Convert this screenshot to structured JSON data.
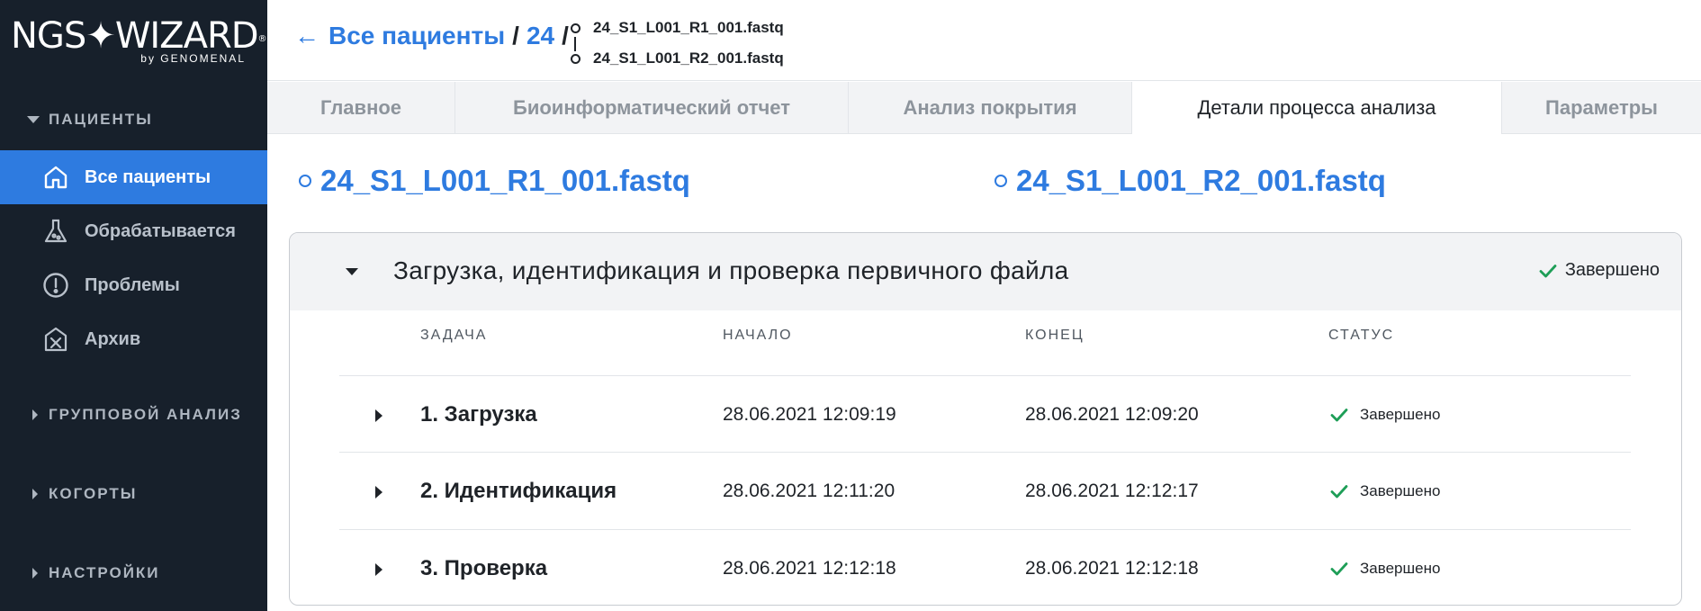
{
  "logo": {
    "main": "NGS✦WIZARD",
    "reg": "®",
    "sub": "by GENOMENAL"
  },
  "sidebar": {
    "patients_header": "ПАЦИЕНТЫ",
    "items": [
      {
        "label": "Все пациенты",
        "icon": "home-icon",
        "active": true
      },
      {
        "label": "Обрабатывается",
        "icon": "flask-icon",
        "active": false
      },
      {
        "label": "Проблемы",
        "icon": "alert-circle-icon",
        "active": false
      },
      {
        "label": "Архив",
        "icon": "archive-icon",
        "active": false
      }
    ],
    "sections": [
      "ГРУППОВОЙ АНАЛИЗ",
      "КОГОРТЫ",
      "НАСТРОЙКИ"
    ]
  },
  "header": {
    "back_arrow": "←",
    "crumb_all": "Все пациенты",
    "sep": "/",
    "crumb_id": "24",
    "file1": "24_S1_L001_R1_001.fastq",
    "file2": "24_S1_L001_R2_001.fastq"
  },
  "tabs": [
    "Главное",
    "Биоинформатический отчет",
    "Анализ покрытия",
    "Детали процесса анализа",
    "Параметры"
  ],
  "active_tab": "Детали процесса анализа",
  "files": {
    "r1": "24_S1_L001_R1_001.fastq",
    "r2": "24_S1_L001_R2_001.fastq"
  },
  "panel": {
    "title": "Загрузка, идентификация и проверка первичного файла",
    "status": "Завершено",
    "columns": {
      "task": "ЗАДАЧА",
      "start": "НАЧАЛО",
      "end": "КОНЕЦ",
      "status": "СТАТУС"
    },
    "rows": [
      {
        "name": "1. Загрузка",
        "start": "28.06.2021 12:09:19",
        "end": "28.06.2021 12:09:20",
        "status": "Завершено"
      },
      {
        "name": "2. Идентификация",
        "start": "28.06.2021 12:11:20",
        "end": "28.06.2021 12:12:17",
        "status": "Завершено"
      },
      {
        "name": "3. Проверка",
        "start": "28.06.2021 12:12:18",
        "end": "28.06.2021 12:12:18",
        "status": "Завершено"
      }
    ]
  },
  "colors": {
    "accent": "#2e7be0",
    "sidebar_bg": "#17202b",
    "success": "#1e9e57"
  }
}
